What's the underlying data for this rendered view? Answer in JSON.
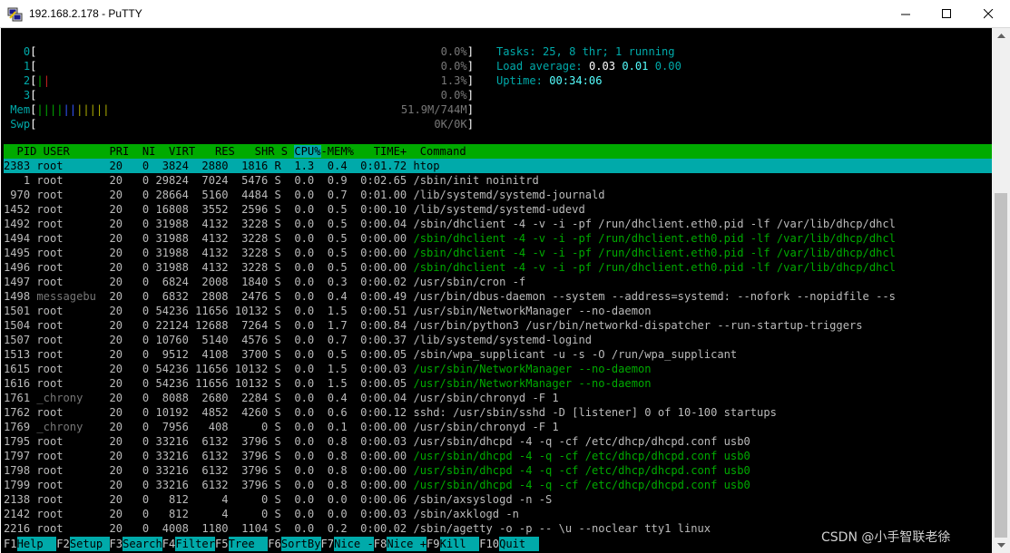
{
  "window": {
    "title": "192.168.2.178 - PuTTY",
    "minimize_icon": "minimize-icon",
    "maximize_icon": "maximize-icon",
    "close_icon": "close-icon",
    "app_icon": "putty-icon"
  },
  "meters": {
    "cpu": [
      {
        "label": "0",
        "value": "0.0%"
      },
      {
        "label": "1",
        "value": "0.0%"
      },
      {
        "label": "2",
        "value": "1.3%"
      },
      {
        "label": "3",
        "value": "0.0%"
      }
    ],
    "mem": {
      "label": "Mem",
      "value": "51.9M/744M"
    },
    "swp": {
      "label": "Swp",
      "value": "0K/0K"
    }
  },
  "summary": {
    "tasks_label": "Tasks: ",
    "tasks_value": "25, 8 thr; 1 running",
    "load_label": "Load average: ",
    "load_1": "0.03",
    "load_5": "0.01",
    "load_15": "0.00",
    "uptime_label": "Uptime: ",
    "uptime_value": "00:34:06"
  },
  "table": {
    "header_left": "  PID USER      PRI  NI  VIRT   RES   SHR S ",
    "header_sort": "CPU%",
    "header_right": "-MEM%   TIME+  Command",
    "selected": "2383 root       20   0  3824  2880  1816 R  1.3  0.4  0:01.72 htop",
    "rows": [
      {
        "line": "   1 root       20   0 29824  7024  5476 S  0.0  0.9  0:02.65 ",
        "cmd": "/sbin/init noinitrd",
        "thread": false,
        "gray_user": false
      },
      {
        "line": " 970 root       20   0 28664  5160  4484 S  0.0  0.7  0:01.00 ",
        "cmd": "/lib/systemd/systemd-journald",
        "thread": false,
        "gray_user": false
      },
      {
        "line": "1452 root       20   0 16808  3552  2596 S  0.0  0.5  0:00.10 ",
        "cmd": "/lib/systemd/systemd-udevd",
        "thread": false,
        "gray_user": false
      },
      {
        "line": "1492 root       20   0 31988  4132  3228 S  0.0  0.5  0:00.04 ",
        "cmd": "/sbin/dhclient -4 -v -i -pf /run/dhclient.eth0.pid -lf /var/lib/dhcp/dhcl",
        "thread": false,
        "gray_user": false
      },
      {
        "line": "1494 root       20   0 31988  4132  3228 S  0.0  0.5  0:00.00 ",
        "cmd": "/sbin/dhclient -4 -v -i -pf /run/dhclient.eth0.pid -lf /var/lib/dhcp/dhcl",
        "thread": true,
        "gray_user": false
      },
      {
        "line": "1495 root       20   0 31988  4132  3228 S  0.0  0.5  0:00.00 ",
        "cmd": "/sbin/dhclient -4 -v -i -pf /run/dhclient.eth0.pid -lf /var/lib/dhcp/dhcl",
        "thread": true,
        "gray_user": false
      },
      {
        "line": "1496 root       20   0 31988  4132  3228 S  0.0  0.5  0:00.00 ",
        "cmd": "/sbin/dhclient -4 -v -i -pf /run/dhclient.eth0.pid -lf /var/lib/dhcp/dhcl",
        "thread": true,
        "gray_user": false
      },
      {
        "line": "1497 root       20   0  6824  2008  1840 S  0.0  0.3  0:00.02 ",
        "cmd": "/usr/sbin/cron -f",
        "thread": false,
        "gray_user": false
      },
      {
        "line": "1498 messagebu  20   0  6832  2808  2476 S  0.0  0.4  0:00.49 ",
        "cmd": "/usr/bin/dbus-daemon --system --address=systemd: --nofork --nopidfile --s",
        "thread": false,
        "gray_user": true
      },
      {
        "line": "1501 root       20   0 54236 11656 10132 S  0.0  1.5  0:00.51 ",
        "cmd": "/usr/sbin/NetworkManager --no-daemon",
        "thread": false,
        "gray_user": false
      },
      {
        "line": "1504 root       20   0 22124 12688  7264 S  0.0  1.7  0:00.84 ",
        "cmd": "/usr/bin/python3 /usr/bin/networkd-dispatcher --run-startup-triggers",
        "thread": false,
        "gray_user": false
      },
      {
        "line": "1507 root       20   0 10760  5140  4576 S  0.0  0.7  0:00.37 ",
        "cmd": "/lib/systemd/systemd-logind",
        "thread": false,
        "gray_user": false
      },
      {
        "line": "1513 root       20   0  9512  4108  3700 S  0.0  0.5  0:00.05 ",
        "cmd": "/sbin/wpa_supplicant -u -s -O /run/wpa_supplicant",
        "thread": false,
        "gray_user": false
      },
      {
        "line": "1615 root       20   0 54236 11656 10132 S  0.0  1.5  0:00.03 ",
        "cmd": "/usr/sbin/NetworkManager --no-daemon",
        "thread": true,
        "gray_user": false
      },
      {
        "line": "1616 root       20   0 54236 11656 10132 S  0.0  1.5  0:00.05 ",
        "cmd": "/usr/sbin/NetworkManager --no-daemon",
        "thread": true,
        "gray_user": false
      },
      {
        "line": "1761 _chrony    20   0  8088  2680  2284 S  0.0  0.4  0:00.04 ",
        "cmd": "/usr/sbin/chronyd -F 1",
        "thread": false,
        "gray_user": true
      },
      {
        "line": "1762 root       20   0 10192  4852  4260 S  0.0  0.6  0:00.12 ",
        "cmd": "sshd: /usr/sbin/sshd -D [listener] 0 of 10-100 startups",
        "thread": false,
        "gray_user": false
      },
      {
        "line": "1769 _chrony    20   0  7956   408     0 S  0.0  0.1  0:00.00 ",
        "cmd": "/usr/sbin/chronyd -F 1",
        "thread": false,
        "gray_user": true
      },
      {
        "line": "1795 root       20   0 33216  6132  3796 S  0.0  0.8  0:00.03 ",
        "cmd": "/usr/sbin/dhcpd -4 -q -cf /etc/dhcp/dhcpd.conf usb0",
        "thread": false,
        "gray_user": false
      },
      {
        "line": "1797 root       20   0 33216  6132  3796 S  0.0  0.8  0:00.00 ",
        "cmd": "/usr/sbin/dhcpd -4 -q -cf /etc/dhcp/dhcpd.conf usb0",
        "thread": true,
        "gray_user": false
      },
      {
        "line": "1798 root       20   0 33216  6132  3796 S  0.0  0.8  0:00.00 ",
        "cmd": "/usr/sbin/dhcpd -4 -q -cf /etc/dhcp/dhcpd.conf usb0",
        "thread": true,
        "gray_user": false
      },
      {
        "line": "1799 root       20   0 33216  6132  3796 S  0.0  0.8  0:00.00 ",
        "cmd": "/usr/sbin/dhcpd -4 -q -cf /etc/dhcp/dhcpd.conf usb0",
        "thread": true,
        "gray_user": false
      },
      {
        "line": "2138 root       20   0   812     4     0 S  0.0  0.0  0:00.06 ",
        "cmd": "/sbin/axsyslogd -n -S",
        "thread": false,
        "gray_user": false
      },
      {
        "line": "2142 root       20   0   812     4     0 S  0.0  0.0  0:00.03 ",
        "cmd": "/sbin/axklogd -n",
        "thread": false,
        "gray_user": false
      },
      {
        "line": "2216 root       20   0  4008  1180  1104 S  0.0  0.2  0:00.02 ",
        "cmd": "/sbin/agetty -o -p -- \\u --noclear tty1 linux",
        "thread": false,
        "gray_user": false
      }
    ]
  },
  "footer": [
    {
      "key": "F1",
      "label": "Help  "
    },
    {
      "key": "F2",
      "label": "Setup "
    },
    {
      "key": "F3",
      "label": "Search"
    },
    {
      "key": "F4",
      "label": "Filter"
    },
    {
      "key": "F5",
      "label": "Tree  "
    },
    {
      "key": "F6",
      "label": "SortBy"
    },
    {
      "key": "F7",
      "label": "Nice -"
    },
    {
      "key": "F8",
      "label": "Nice +"
    },
    {
      "key": "F9",
      "label": "Kill  "
    },
    {
      "key": "F10",
      "label": "Quit  "
    }
  ],
  "watermark": "CSDN @小手智联老徐",
  "colors": {
    "header_bg": "#00aa00",
    "selected_bg": "#00aaaa",
    "terminal_bg": "#000000",
    "thread_text": "#00aa00"
  }
}
